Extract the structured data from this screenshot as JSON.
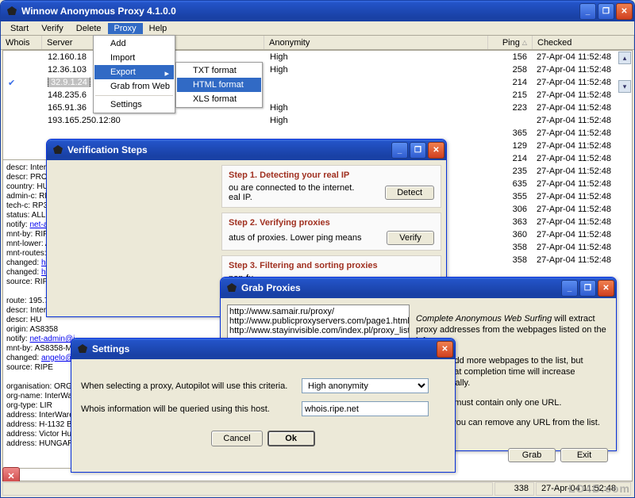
{
  "window": {
    "title": "Winnow Anonymous Proxy 4.1.0.0"
  },
  "menubar": [
    "Start",
    "Verify",
    "Delete",
    "Proxy",
    "Help"
  ],
  "menu_active_index": 3,
  "proxy_menu": {
    "items": [
      "Add",
      "Import",
      "Export",
      "Grab from Web",
      "Settings"
    ],
    "export_sub": [
      "TXT format",
      "HTML format",
      "XLS format"
    ],
    "export_active_index": 1
  },
  "columns": {
    "whois": "Whois",
    "server": "Server",
    "anonymity": "Anonymity",
    "ping": "Ping",
    "checked": "Checked"
  },
  "rows": [
    {
      "server": "12.160.18",
      "anonymity": "High",
      "ping": "156",
      "checked": "27-Apr-04 11:52:48"
    },
    {
      "server": "12.36.103",
      "anonymity": "High",
      "ping": "258",
      "checked": "27-Apr-04 11:52:48"
    },
    {
      "server": "32.9.1.24",
      "anonymity": "",
      "ping": "214",
      "checked": "27-Apr-04 11:52:48",
      "selected": true
    },
    {
      "server": "148.235.6",
      "anonymity": "",
      "ping": "215",
      "checked": "27-Apr-04 11:52:48"
    },
    {
      "server": "165.91.36",
      "anonymity": "High",
      "ping": "223",
      "checked": "27-Apr-04 11:52:48"
    },
    {
      "server": "193.165.250.12:80",
      "anonymity": "High",
      "ping": "",
      "checked": "27-Apr-04 11:52:48"
    },
    {
      "server": "",
      "anonymity": "",
      "ping": "365",
      "checked": "27-Apr-04 11:52:48"
    },
    {
      "server": "",
      "anonymity": "",
      "ping": "129",
      "checked": "27-Apr-04 11:52:48"
    },
    {
      "server": "",
      "anonymity": "",
      "ping": "214",
      "checked": "27-Apr-04 11:52:48"
    },
    {
      "server": "",
      "anonymity": "",
      "ping": "235",
      "checked": "27-Apr-04 11:52:48"
    },
    {
      "server": "",
      "anonymity": "",
      "ping": "635",
      "checked": "27-Apr-04 11:52:48"
    },
    {
      "server": "",
      "anonymity": "",
      "ping": "355",
      "checked": "27-Apr-04 11:52:48"
    },
    {
      "server": "",
      "anonymity": "",
      "ping": "306",
      "checked": "27-Apr-04 11:52:48"
    },
    {
      "server": "",
      "anonymity": "",
      "ping": "363",
      "checked": "27-Apr-04 11:52:48"
    },
    {
      "server": "",
      "anonymity": "",
      "ping": "360",
      "checked": "27-Apr-04 11:52:48"
    },
    {
      "server": "",
      "anonymity": "",
      "ping": "358",
      "checked": "27-Apr-04 11:52:48"
    },
    {
      "server": "",
      "anonymity": "",
      "ping": "358",
      "checked": "27-Apr-04 11:52:48"
    }
  ],
  "verification": {
    "title": "Verification Steps",
    "step1": {
      "title": "Step 1. Detecting your real IP",
      "desc": "ou are connected to the internet.\neal IP.",
      "btn": "Detect"
    },
    "step2": {
      "title": "Step 2. Verifying proxies",
      "desc": "atus of proxies. Lower ping means",
      "btn": "Verify"
    },
    "step3": {
      "title": "Step 3. Filtering and sorting proxies",
      "desc": "non-fu\nby Pi"
    }
  },
  "grab": {
    "title": "Grab Proxies",
    "urls": [
      "http://www.samair.ru/proxy/",
      "http://www.publicproxyservers.com/page1.html",
      "http://www.stayinvisible.com/index.pl/proxy_list"
    ],
    "text1": "Complete Anonymous Web Surfing",
    "text1b": " will extract proxy addresses from the webpages listed on the left.",
    "text2": "You can add more webpages to the list, but beware that completion time will increase proportionally.",
    "text3": "Each line must contain only one URL.",
    "text4": "Likewise you can remove any URL from the list.",
    "btn_grab": "Grab",
    "btn_exit": "Exit"
  },
  "settings": {
    "title": "Settings",
    "label1": "When selecting a proxy, Autopilot will use this criteria.",
    "value1": "High anonymity",
    "label2": "Whois information will be queried using this host.",
    "value2": "whois.ripe.net",
    "btn_cancel": "Cancel",
    "btn_ok": "Ok"
  },
  "whois": {
    "lines": [
      "descr:     InterWare Ltd.",
      "descr:     PROVIDER LIR",
      "country:   HU",
      "admin-c:   RP372-RIPE",
      "tech-c:    RP372-RIPE",
      "status:    ALLOCATED PA",
      "notify:    net-admin@interware.hu",
      "mnt-by:    RIPE-NCC-HM-MNT",
      "mnt-lower: AS8358-MNT",
      "mnt-routes: AS8358-MNT",
      "changed:   hostmaster@ripe.net 19970704",
      "changed:   hostmaster@ripe.net 20021113",
      "source:    RIPE",
      "",
      "route:     195.70.32.0/19",
      "descr:     InterWare Inc.",
      "descr:     HU",
      "origin:    AS8358",
      "notify:    net-admin@i",
      "mnt-by:    AS8358-MN",
      "changed:   angelo@i",
      "source:    RIPE",
      "",
      "organisation: ORG-IL7-F",
      "org-name:   InterWare",
      "org-type:   LIR",
      "address:    InterWare L",
      "address:    H-1132 Bu",
      "address:    Victor Hugo",
      "address:    HUNGARY"
    ]
  },
  "statusbar": {
    "count": "338",
    "date": "27-Apr-04 11:52:48"
  },
  "watermark": "LO4D.com"
}
